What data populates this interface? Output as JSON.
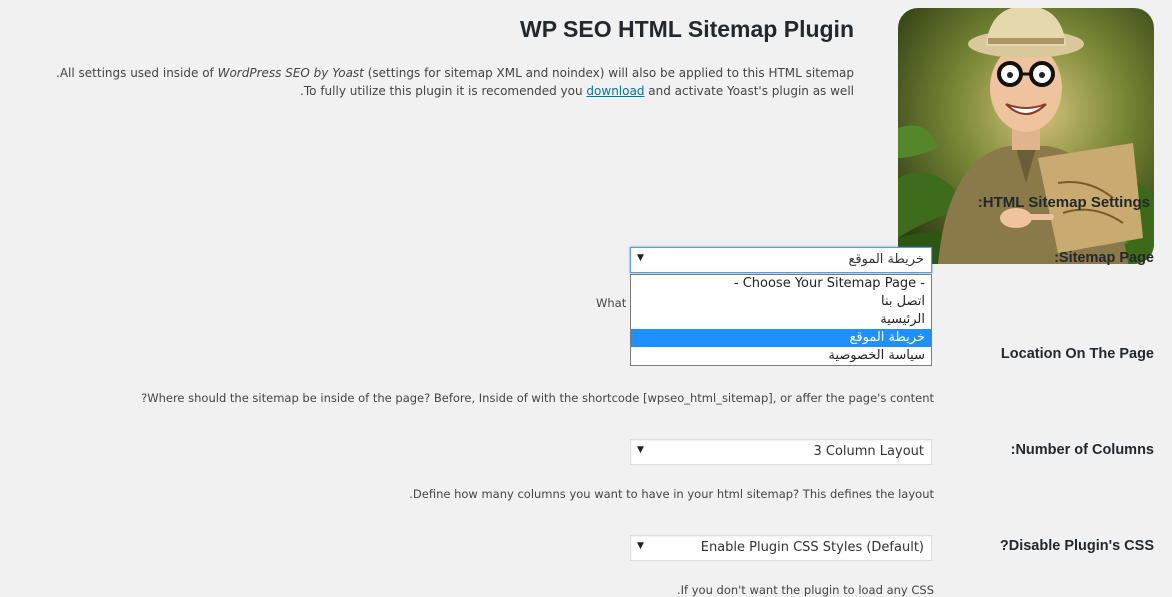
{
  "header": {
    "title": "WP SEO HTML Sitemap Plugin",
    "intro_line1_prefix": "All settings used inside of",
    "intro_line1_italic": "WordPress SEO by Yoast",
    "intro_line1_suffix": "(settings for sitemap XML and noindex) will also be applied to this HTML sitemap.",
    "intro_line2_prefix": "To fully utilize this plugin it is recomended you",
    "intro_line2_link": "download",
    "intro_line2_suffix": "and activate Yoast's plugin as well."
  },
  "settings": {
    "heading": "HTML Sitemap Settings:",
    "sitemap_page": {
      "label": "Sitemap Page:",
      "selected": "خريطة الموقع",
      "help_partial": "What",
      "options": [
        "- Choose Your Sitemap Page -",
        "اتصل بنا",
        "الرئيسية",
        "خريطة الموقع",
        "سياسة الخصوصية"
      ],
      "selected_index": 3
    },
    "location": {
      "label": "Location On The Page",
      "help": "Where should the sitemap be inside of the page? Before, Inside of with the shortcode [wpseo_html_sitemap], or affer the page's content?"
    },
    "columns": {
      "label": "Number of Columns:",
      "selected": "3 Column Layout",
      "help": "Define how many columns you want to have in your html sitemap? This defines the layout."
    },
    "css": {
      "label": "Disable Plugin's CSS?",
      "selected": "Enable Plugin CSS Styles (Default)",
      "help": "If you don't want the plugin to load any CSS."
    }
  },
  "image": {
    "alt": "explorer-illustration"
  },
  "colors": {
    "accent": "#1e90ff",
    "link": "#0073aa",
    "background": "#f1f1f1"
  }
}
